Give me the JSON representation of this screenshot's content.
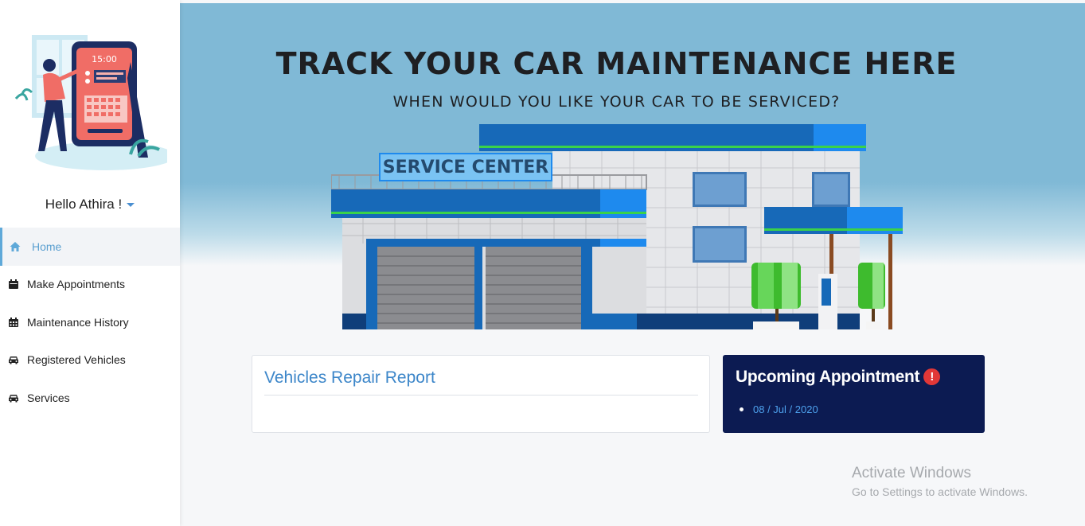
{
  "sidebar": {
    "greeting": "Hello Athira !",
    "illustration_clock": "15:00",
    "nav": [
      {
        "label": "Home",
        "icon": "home-icon",
        "active": true
      },
      {
        "label": "Make Appointments",
        "icon": "calendar-icon"
      },
      {
        "label": "Maintenance History",
        "icon": "calendar-grid-icon"
      },
      {
        "label": "Registered Vehicles",
        "icon": "car-icon"
      },
      {
        "label": "Services",
        "icon": "car-icon"
      }
    ]
  },
  "hero": {
    "title": "TRACK YOUR CAR MAINTENANCE HERE",
    "subtitle": "WHEN WOULD YOU LIKE YOUR CAR TO BE SERVICED?",
    "sign": "SERVICE CENTER"
  },
  "cards": {
    "report_title": "Vehicles Repair Report",
    "upcoming_title": "Upcoming Appointment",
    "upcoming_items": [
      "08 / Jul / 2020"
    ]
  },
  "watermark": {
    "line1": "Activate Windows",
    "line2": "Go to Settings to activate Windows."
  },
  "colors": {
    "accent": "#5fa9d9",
    "hero_sky": "#80b9d6",
    "upcoming_bg": "#0c1b52",
    "link_blue": "#3c86c9",
    "alert_red": "#e13737"
  }
}
